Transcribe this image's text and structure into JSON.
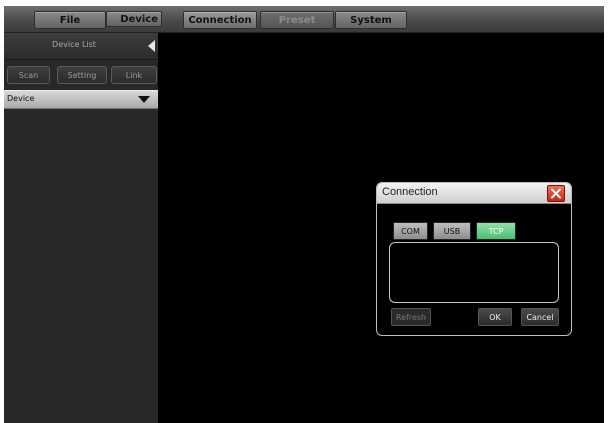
{
  "menu": {
    "file": "File",
    "device": "Device",
    "connection": "Connection",
    "preset": "Preset",
    "system": "System"
  },
  "sidebar": {
    "title": "Device List",
    "toolbar": {
      "scan": "Scan",
      "setting": "Setting",
      "link": "Link"
    },
    "device_dropdown": "Device"
  },
  "dialog": {
    "title": "Connection",
    "tabs": [
      {
        "label": "COM",
        "active": false
      },
      {
        "label": "USB",
        "active": false
      },
      {
        "label": "TCP",
        "active": true
      }
    ],
    "buttons": {
      "refresh": "Refresh",
      "ok": "OK",
      "cancel": "Cancel"
    }
  },
  "colors": {
    "background": "#000000",
    "active_tab": "#5fcc84",
    "close_button": "#e0483a",
    "device_row": "#c2c2c2"
  },
  "icons": {
    "collapse": "triangle-left-icon",
    "dropdown": "caret-down-icon",
    "close": "close-icon"
  }
}
